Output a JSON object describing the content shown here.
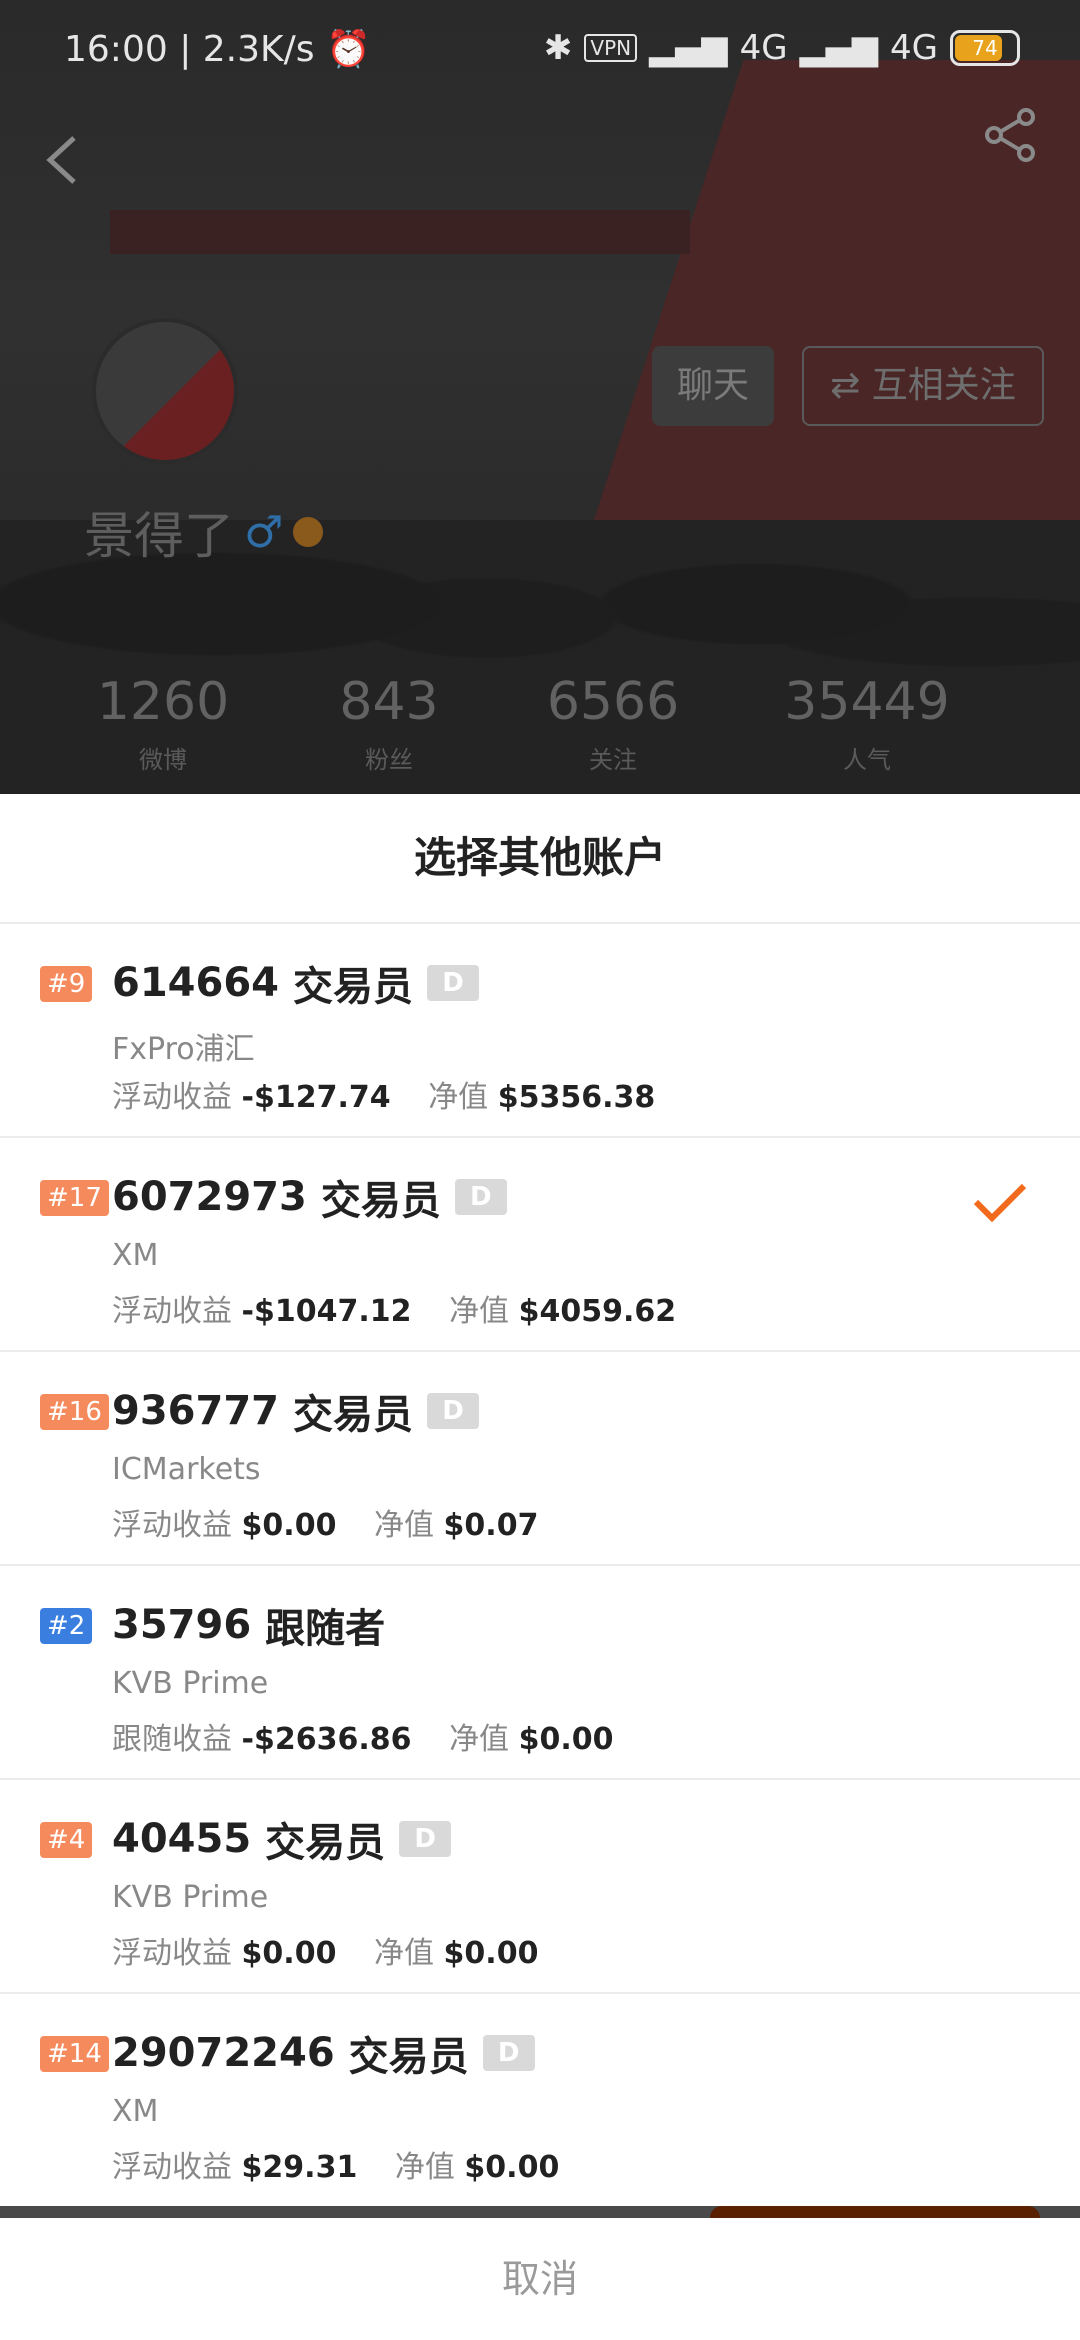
{
  "status_bar": {
    "time": "16:00",
    "speed": "2.3K/s",
    "vpn": "VPN",
    "net1": "4G",
    "net2": "4G",
    "battery": "74"
  },
  "profile": {
    "name": "景得了",
    "chat_label": "聊天",
    "follow_label": "互相关注",
    "stats": [
      {
        "value": "1260",
        "label": "微博"
      },
      {
        "value": "843",
        "label": "粉丝"
      },
      {
        "value": "6566",
        "label": "关注"
      },
      {
        "value": "35449",
        "label": "人气"
      }
    ]
  },
  "sheet": {
    "title": "选择其他账户",
    "accounts": [
      {
        "rank": "#9",
        "id": "614664",
        "role": "交易员",
        "badge": "D",
        "broker": "FxPro浦汇",
        "metric_label": "浮动收益",
        "metric_value": "-$127.74",
        "equity_label": "净值",
        "equity_value": "$5356.38",
        "selected": false
      },
      {
        "rank": "#17",
        "id": "6072973",
        "role": "交易员",
        "badge": "D",
        "broker": "XM",
        "metric_label": "浮动收益",
        "metric_value": "-$1047.12",
        "equity_label": "净值",
        "equity_value": "$4059.62",
        "selected": true
      },
      {
        "rank": "#16",
        "id": "936777",
        "role": "交易员",
        "badge": "D",
        "broker": "ICMarkets",
        "metric_label": "浮动收益",
        "metric_value": "$0.00",
        "equity_label": "净值",
        "equity_value": "$0.07",
        "selected": false
      },
      {
        "rank": "#2",
        "id": "35796",
        "role": "跟随者",
        "badge": "",
        "broker": "KVB Prime",
        "metric_label": "跟随收益",
        "metric_value": "-$2636.86",
        "equity_label": "净值",
        "equity_value": "$0.00",
        "selected": false
      },
      {
        "rank": "#4",
        "id": "40455",
        "role": "交易员",
        "badge": "D",
        "broker": "KVB Prime",
        "metric_label": "浮动收益",
        "metric_value": "$0.00",
        "equity_label": "净值",
        "equity_value": "$0.00",
        "selected": false
      },
      {
        "rank": "#14",
        "id": "29072246",
        "role": "交易员",
        "badge": "D",
        "broker": "XM",
        "metric_label": "浮动收益",
        "metric_value": "$29.31",
        "equity_label": "净值",
        "equity_value": "$0.00",
        "selected": false
      }
    ],
    "cancel_label": "取消"
  },
  "colors": {
    "accent": "#f26a1b",
    "rank_orange": "#f58a5c",
    "rank_blue": "#3a7fe0"
  }
}
